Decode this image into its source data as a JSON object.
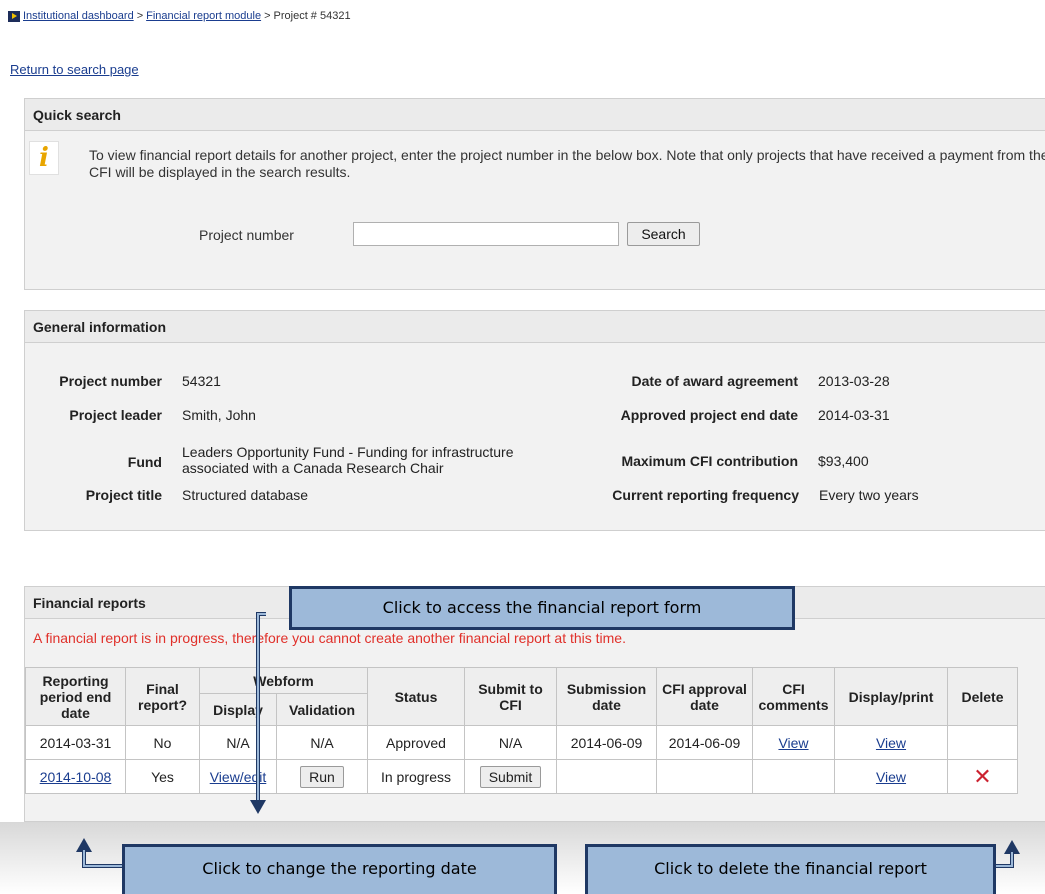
{
  "breadcrumb": {
    "items": [
      "Institutional dashboard",
      "Financial report module"
    ],
    "separator": ">",
    "current": "Project # 54321"
  },
  "return_link": "Return to search page",
  "quick_search": {
    "title": "Quick search",
    "info_text": "To view financial report details for another project, enter the project number in the below box. Note that only projects that have received a payment from the CFI will be displayed in the search results.",
    "field_label": "Project number",
    "field_value": "",
    "button": "Search"
  },
  "general_info": {
    "title": "General information",
    "left": [
      {
        "label": "Project number",
        "value": "54321"
      },
      {
        "label": "Project leader",
        "value": "Smith, John"
      },
      {
        "label": "Fund",
        "value": "Leaders Opportunity Fund - Funding for infrastructure associated with a Canada Research Chair"
      },
      {
        "label": "Project title",
        "value": "Structured database"
      }
    ],
    "right": [
      {
        "label": "Date of award agreement",
        "value": "2013-03-28"
      },
      {
        "label": "Approved project end date",
        "value": "2014-03-31"
      },
      {
        "label": "Maximum CFI contribution",
        "value": "$93,400"
      },
      {
        "label": "Current reporting frequency",
        "value": "Every two years"
      }
    ]
  },
  "financial_reports": {
    "title": "Financial reports",
    "warning": "A financial report is in progress, therefore you cannot create another financial report at this time.",
    "headers": {
      "period": "Reporting period end date",
      "final": "Final report?",
      "webform": "Webform",
      "display": "Display",
      "validation": "Validation",
      "status": "Status",
      "submit": "Submit to CFI",
      "submission_date": "Submission date",
      "approval_date": "CFI approval date",
      "comments": "CFI comments",
      "display_print": "Display/print",
      "delete": "Delete"
    },
    "rows": [
      {
        "period": "2014-03-31",
        "final": "No",
        "display": "N/A",
        "validation": "N/A",
        "status": "Approved",
        "submit": "N/A",
        "submission_date": "2014-06-09",
        "approval_date": "2014-06-09",
        "comments": "View",
        "display_print": "View",
        "delete": ""
      },
      {
        "period": "2014-10-08",
        "final": "Yes",
        "display": "View/edit",
        "validation": "Run",
        "status": "In progress",
        "submit": "Submit",
        "submission_date": "",
        "approval_date": "",
        "comments": "",
        "display_print": "View",
        "delete": "✕"
      }
    ]
  },
  "callouts": {
    "form": "Click to access the financial report form",
    "date": "Click to change the reporting date",
    "delete": "Click to delete the financial report"
  },
  "colors": {
    "callout_fill": "#9db9d9",
    "callout_border": "#1f3864",
    "warning": "#e0302a",
    "link": "#1a3d8f",
    "delete": "#cc2230"
  }
}
